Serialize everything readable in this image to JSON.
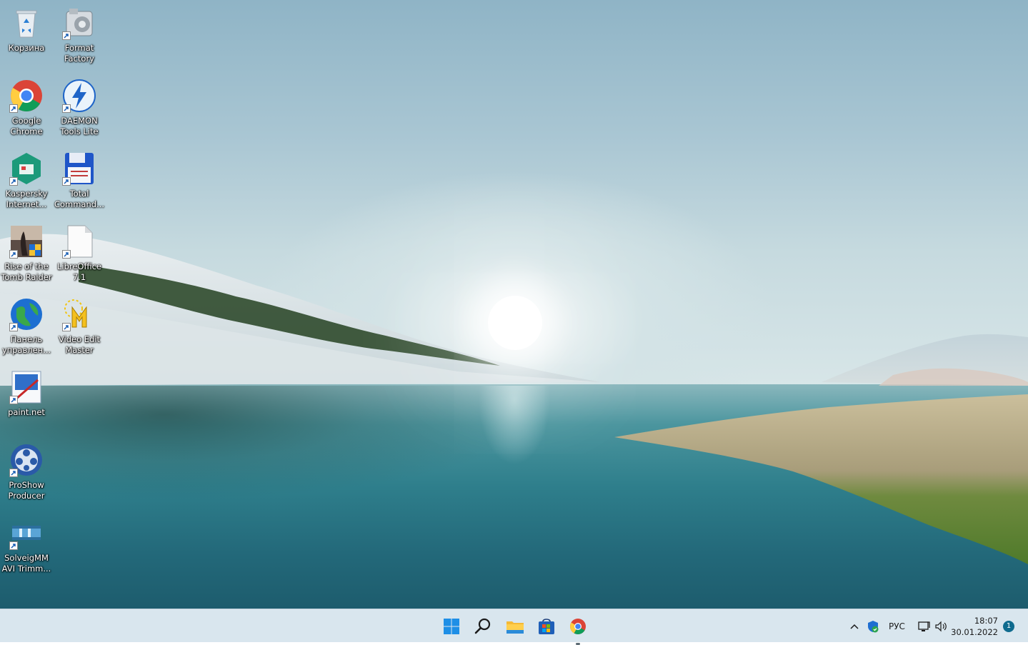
{
  "desktop": {
    "icons": [
      {
        "label": "Корзина",
        "icon": "recycle-bin-icon"
      },
      {
        "label": "Format\nFactory",
        "icon": "format-factory-icon"
      },
      {
        "label": "Google\nChrome",
        "icon": "chrome-icon"
      },
      {
        "label": "DAEMON\nTools Lite",
        "icon": "daemon-tools-icon"
      },
      {
        "label": "Kaspersky\nInternet...",
        "icon": "kaspersky-icon"
      },
      {
        "label": "Total\nCommand...",
        "icon": "total-commander-icon"
      },
      {
        "label": "Rise of the\nTomb Raider",
        "icon": "tomb-raider-icon"
      },
      {
        "label": "LibreOffice\n7.1",
        "icon": "libreoffice-icon"
      },
      {
        "label": "Панель\nуправлен...",
        "icon": "control-panel-icon"
      },
      {
        "label": "Video Edit\nMaster",
        "icon": "video-edit-master-icon"
      },
      {
        "label": "paint.net",
        "icon": "paint-net-icon"
      },
      {
        "label": "ProShow\nProducer",
        "icon": "proshow-icon"
      },
      {
        "label": "SolveigMM\nAVI Trimm...",
        "icon": "solveigmm-icon"
      }
    ]
  },
  "taskbar": {
    "pinned": [
      {
        "name": "start",
        "icon": "windows-start-icon"
      },
      {
        "name": "search",
        "icon": "search-icon"
      },
      {
        "name": "file-explorer",
        "icon": "folder-icon"
      },
      {
        "name": "microsoft-store",
        "icon": "store-icon"
      },
      {
        "name": "chrome",
        "icon": "chrome-icon",
        "active": true
      }
    ],
    "tray": {
      "language": "РУС",
      "time": "18:07",
      "date": "30.01.2022",
      "notifications": "1"
    }
  },
  "colors": {
    "taskbar_bg": "#d9e6ee",
    "accent": "#0f6b8e"
  }
}
